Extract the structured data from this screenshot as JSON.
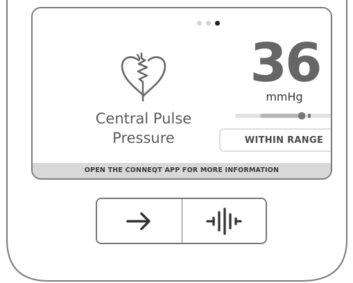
{
  "screen": {
    "page_indicator": {
      "total_pages": 3,
      "active_page": 3
    },
    "metric": {
      "icon": "heart-wave-icon",
      "title_line_1": "Central Pulse",
      "title_line_2": "Pressure",
      "value": "36",
      "unit": "mmHg",
      "range_position": 0.68,
      "status": "WITHIN RANGE"
    },
    "footer": {
      "message": "OPEN THE CONNEQT APP FOR MORE INFORMATION"
    }
  },
  "controls": {
    "left_icon": "right-arrow-icon",
    "right_icon": "waveform-icon"
  },
  "colors": {
    "outline": "#757575",
    "value_text": "#666666",
    "footer_background": "#d8d8d8",
    "status_border": "#dedede",
    "active_dot": "#222222",
    "inactive_dot": "#d3d3d3"
  }
}
